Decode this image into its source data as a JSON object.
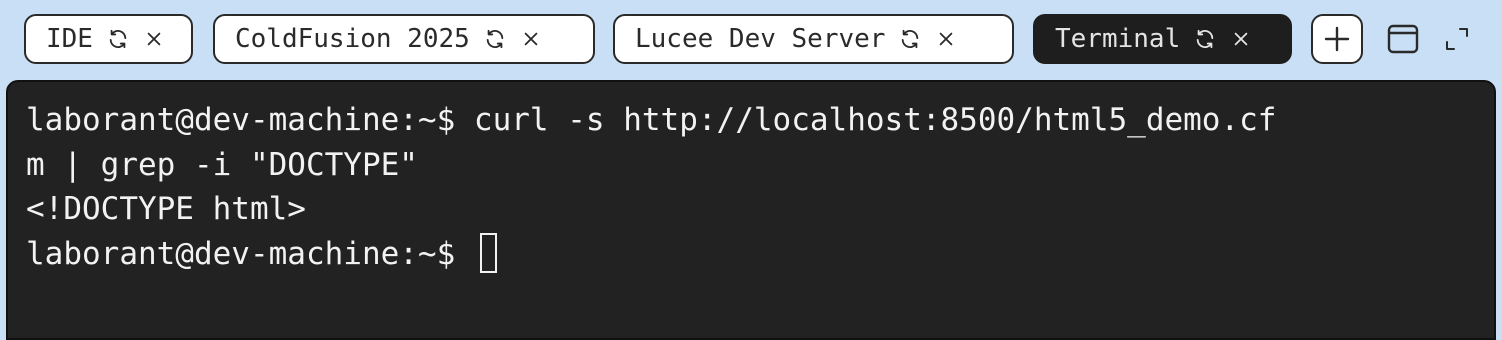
{
  "tabs": [
    {
      "label": "IDE",
      "active": false
    },
    {
      "label": "ColdFusion 2025",
      "active": false
    },
    {
      "label": "Lucee Dev Server",
      "active": false
    },
    {
      "label": "Terminal",
      "active": true
    }
  ],
  "icons": {
    "refresh": "refresh-icon",
    "close": "close-icon",
    "new_tab": "plus-icon",
    "window": "window-icon",
    "fullscreen": "expand-icon"
  },
  "colors": {
    "background": "#c8dff5",
    "terminal_bg": "#222222",
    "terminal_text": "#f2f2f2",
    "active_tab_bg": "#1e1e1e",
    "inactive_tab_bg": "#ffffff"
  },
  "terminal": {
    "lines": [
      "laborant@dev-machine:~$ curl -s http://localhost:8500/html5_demo.cf",
      "m | grep -i \"DOCTYPE\"",
      "<!DOCTYPE html>"
    ],
    "prompt": "laborant@dev-machine:~$ "
  }
}
